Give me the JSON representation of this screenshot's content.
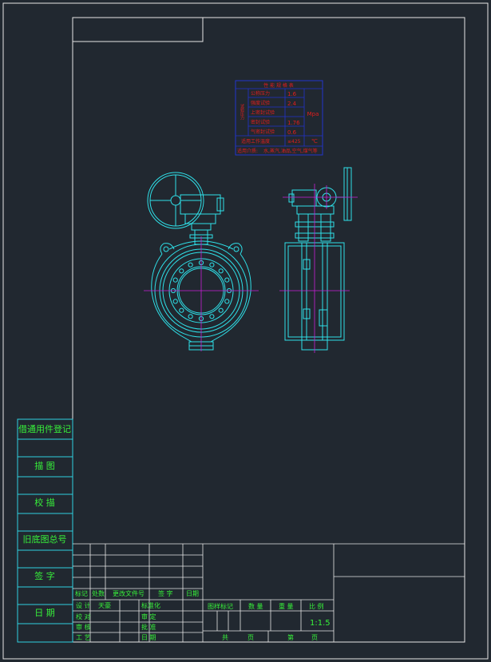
{
  "colors": {
    "background": "#212830",
    "frame": "#e6e6e6",
    "title_lines": "#2ed1e0",
    "title_text": "#37f03a",
    "drawing": "#2fe0e8",
    "centerline": "#c81ed8",
    "table_border": "#2233cc",
    "table_text": "#e01e1e"
  },
  "left_strip": {
    "labels": [
      "借通用件登记",
      "描 图",
      "校 描",
      "旧底图总号",
      "签 字",
      "日 期"
    ]
  },
  "spec_table": {
    "title": "性 能 规 格 表",
    "group_label": "试验压力",
    "rows": [
      {
        "label": "公称压力",
        "value": "1.6"
      },
      {
        "label": "强度试验",
        "value": "2.4"
      },
      {
        "label": "上密封试验",
        "value": ""
      },
      {
        "label": "密封试验",
        "value": "1.76"
      },
      {
        "label": "气密封试验",
        "value": "0.6"
      }
    ],
    "unit": "Mpa",
    "temp_label": "适用工作温度",
    "temp_value": "≤425",
    "temp_unit": "℃",
    "medium_label": "适用介质:",
    "medium_value": "水,蒸汽,油品,空气,煤气等"
  },
  "title_block": {
    "rev_headers": [
      "标记",
      "处数",
      "更改文件号",
      "签 字",
      "日期"
    ],
    "sign_labels": [
      "设 计",
      "校 对",
      "审 核",
      "工 艺"
    ],
    "sign_values": [
      "天豪",
      "",
      "",
      ""
    ],
    "sign_labels2": [
      "标准化",
      "审 定",
      "批 准",
      "日 期"
    ],
    "stage_label": "图样标记",
    "weight_label": "数 量",
    "qty_label": "重 量",
    "scale_label": "比 例",
    "scale_value": "1:1.5",
    "total_label": "共",
    "page_unit": "页",
    "sheet_label": "第",
    "sheet_unit": "页"
  }
}
